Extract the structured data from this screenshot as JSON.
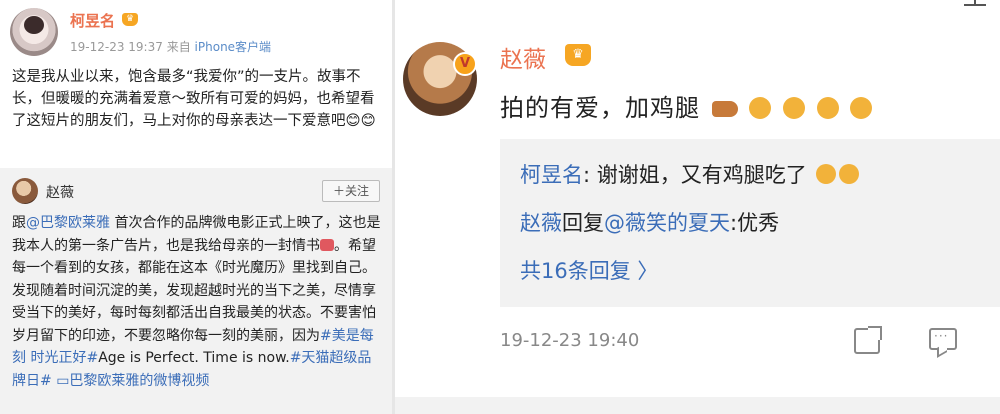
{
  "left_post": {
    "user_name": "柯昱名",
    "meta_time": "19-12-23 19:37",
    "meta_from": "来自",
    "meta_source": "iPhone客户端",
    "text": "这是我从业以来，饱含最多“我爱你”的一支片。故事不长，但暖暖的充满着爱意～致所有可爱的妈妈，也希望看了这短片的朋友们，马上对你的母亲表达一下爱意吧😊😊"
  },
  "repost": {
    "user_name": "赵薇",
    "follow_label": "＋关注",
    "text_prefix": "跟",
    "mention_brand": "@巴黎欧莱雅",
    "text_1": " 首次合作的品牌微电影正式上映了，这也是我本人的第一条广告片，也是我给母亲的一封情书",
    "text_2": "。希望每一个看到的女孩，都能在这本《时光魔历》里找到自己。发现随着时间沉淀的美，发现超越时光的当下之美，尽情享受当下的美好，每时每刻都活出自我最美的状态。不要害怕岁月留下的印迹，不要忽略你每一刻的美丽，因为",
    "tag_1": "#美是每刻 时光正好#",
    "text_3": "Age is Perfect. Time is now.",
    "tag_2": "#天猫超级品牌日#",
    "video_link": "巴黎欧莱雅的微博视频"
  },
  "right_comment": {
    "user_name": "赵薇",
    "verified_badge": "V",
    "comment_text": "拍的有爱，加鸡腿",
    "replies": [
      {
        "user": "柯昱名",
        "sep": ":",
        "text": " 谢谢姐，又有鸡腿吃了"
      },
      {
        "user": "赵薇",
        "action": "回复",
        "mention": "@薇笑的夏天",
        "sep": ":",
        "text": "优秀"
      }
    ],
    "more_replies": "共16条回复 〉",
    "timestamp": "19-12-23 19:40"
  },
  "icons": {
    "crown": "crown-icon",
    "share": "share-icon",
    "comment": "comment-icon"
  },
  "colors": {
    "username": "#eb7350",
    "link": "#3b6db8",
    "panel_bg": "#f2f2f2"
  }
}
